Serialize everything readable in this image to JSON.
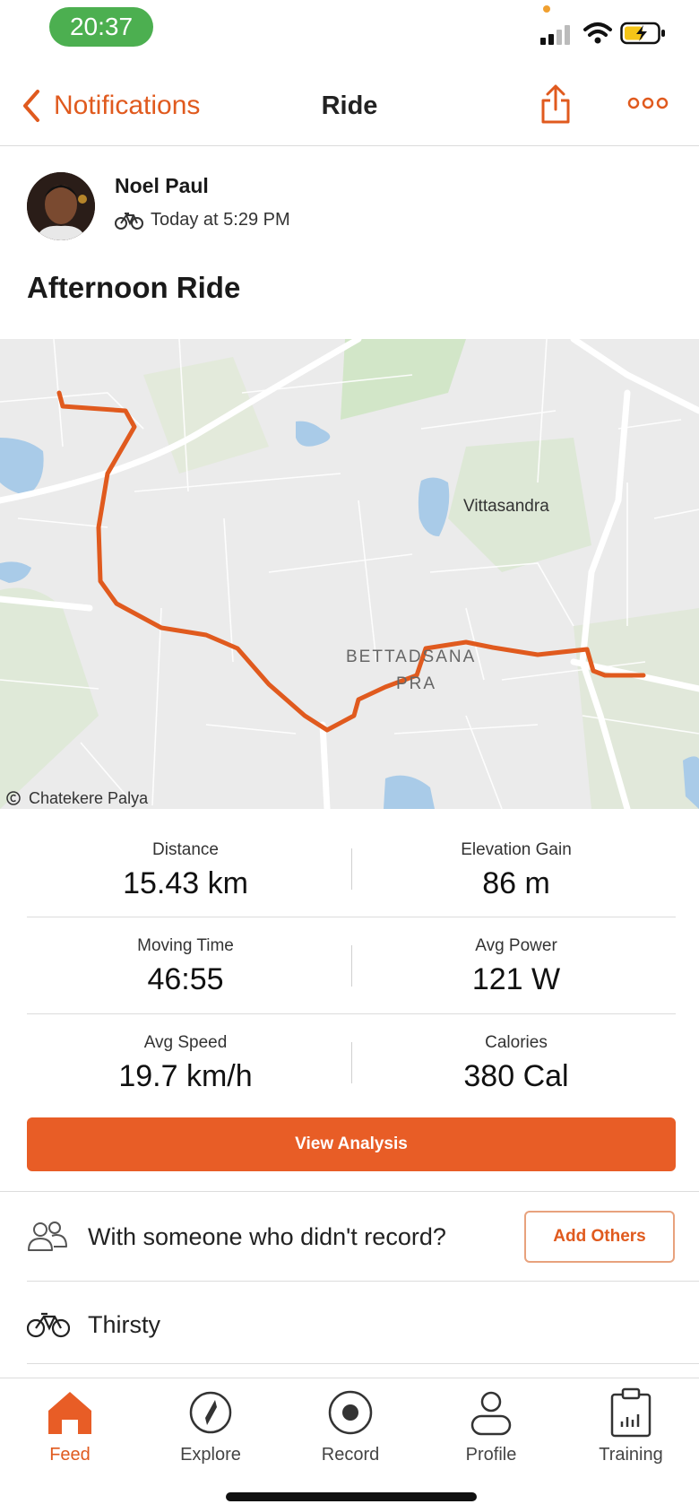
{
  "status_bar": {
    "time": "20:37"
  },
  "nav": {
    "back_label": "Notifications",
    "title": "Ride"
  },
  "activity": {
    "athlete_name": "Noel Paul",
    "date": "Today at 5:29 PM",
    "title": "Afternoon Ride"
  },
  "map": {
    "labels": {
      "vittasandra": "Vittasandra",
      "bettadasanapura_1": "BETTAD​SANA",
      "bettadasanapura_2": "P​RA",
      "chatekere": "Chatekere Palya"
    },
    "route_color": "#e05a1e"
  },
  "stats": [
    {
      "label": "Distance",
      "value": "15.43 km"
    },
    {
      "label": "Elevation Gain",
      "value": "86 m"
    },
    {
      "label": "Moving Time",
      "value": "46:55"
    },
    {
      "label": "Avg Power",
      "value": "121 W"
    },
    {
      "label": "Avg Speed",
      "value": "19.7 km/h"
    },
    {
      "label": "Calories",
      "value": "380 Cal"
    }
  ],
  "buttons": {
    "view_analysis": "View Analysis",
    "add_others": "Add Others"
  },
  "rows": {
    "with_someone": "With someone who didn't record?",
    "bike": "Thirsty"
  },
  "tabs": [
    {
      "label": "Feed",
      "icon": "home-icon",
      "active": true
    },
    {
      "label": "Explore",
      "icon": "compass-icon",
      "active": false
    },
    {
      "label": "Record",
      "icon": "record-icon",
      "active": false
    },
    {
      "label": "Profile",
      "icon": "profile-icon",
      "active": false
    },
    {
      "label": "Training",
      "icon": "training-icon",
      "active": false
    }
  ],
  "colors": {
    "accent": "#e05a1e",
    "status_green": "#4caf50"
  }
}
